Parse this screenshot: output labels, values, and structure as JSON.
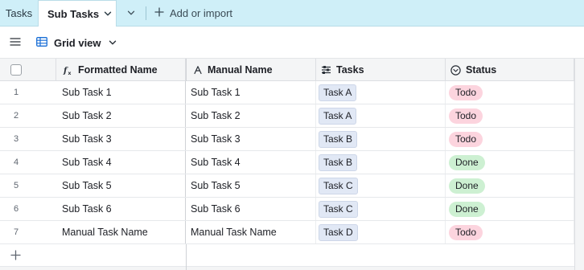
{
  "tabs": {
    "tab1_label": "Tasks",
    "tab2_label": "Sub Tasks",
    "add_label": "Add or import"
  },
  "toolbar": {
    "view_label": "Grid view"
  },
  "columns": {
    "formatted_name": "Formatted Name",
    "manual_name": "Manual Name",
    "tasks": "Tasks",
    "status": "Status"
  },
  "rows": [
    {
      "num": "1",
      "fname": "Sub Task 1",
      "mname": "Sub Task 1",
      "task": "Task A",
      "status": "Todo"
    },
    {
      "num": "2",
      "fname": "Sub Task 2",
      "mname": "Sub Task 2",
      "task": "Task A",
      "status": "Todo"
    },
    {
      "num": "3",
      "fname": "Sub Task 3",
      "mname": "Sub Task 3",
      "task": "Task B",
      "status": "Todo"
    },
    {
      "num": "4",
      "fname": "Sub Task 4",
      "mname": "Sub Task 4",
      "task": "Task B",
      "status": "Done"
    },
    {
      "num": "5",
      "fname": "Sub Task 5",
      "mname": "Sub Task 5",
      "task": "Task C",
      "status": "Done"
    },
    {
      "num": "6",
      "fname": "Sub Task 6",
      "mname": "Sub Task 6",
      "task": "Task C",
      "status": "Done"
    },
    {
      "num": "7",
      "fname": "Manual Task Name",
      "mname": "Manual Task Name",
      "task": "Task D",
      "status": "Todo"
    }
  ],
  "colors": {
    "tab_bar": "#cfeff8",
    "todo": "#fcd4de",
    "done": "#cdf0d2",
    "task_chip": "#e1e8f5"
  },
  "icons": [
    "chevron-down-icon",
    "plus-icon",
    "menu-icon",
    "grid-view-icon",
    "formula-icon",
    "text-field-icon",
    "linked-record-icon",
    "single-select-icon"
  ]
}
